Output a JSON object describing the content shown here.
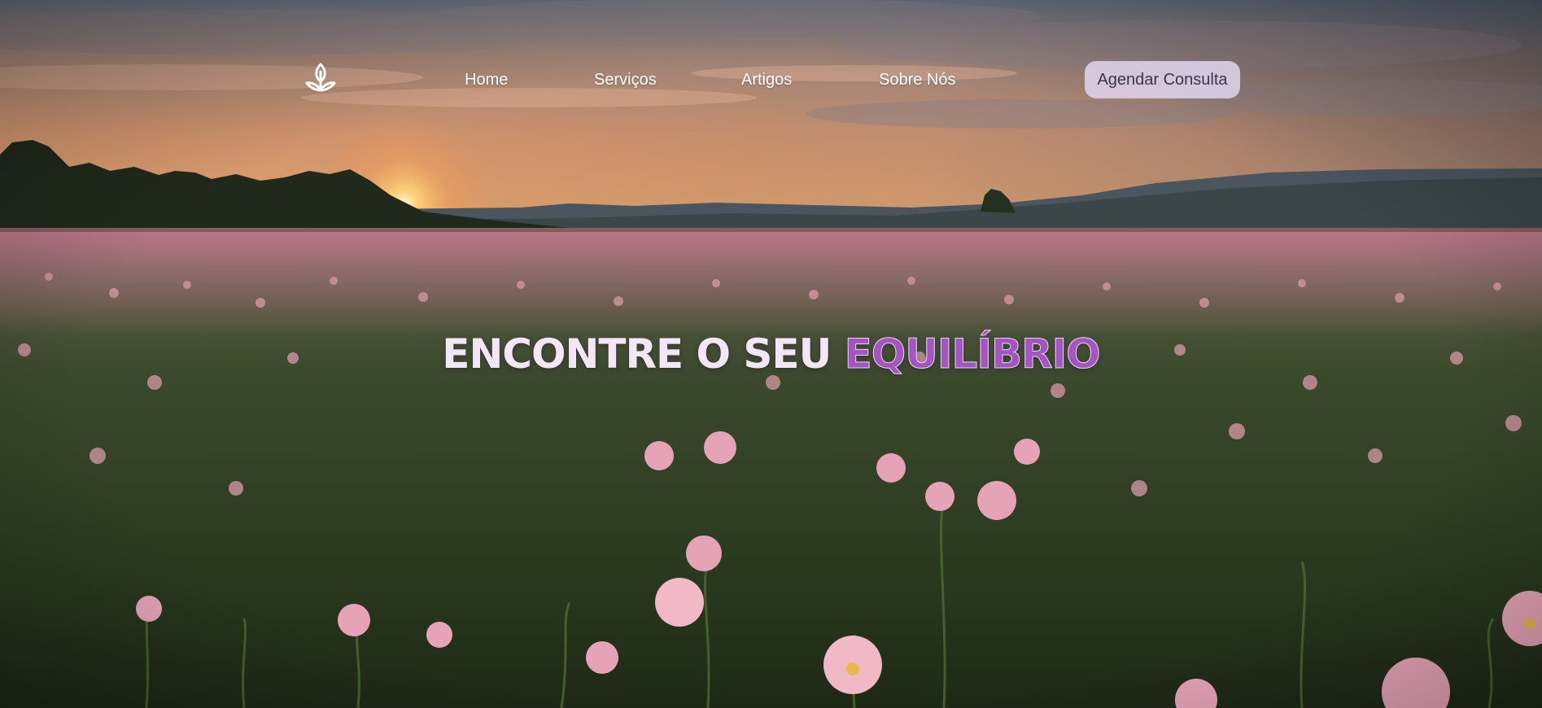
{
  "nav": {
    "logo_icon": "sprout-lotus-icon",
    "links": [
      {
        "label": "Home"
      },
      {
        "label": "Serviços"
      },
      {
        "label": "Artigos"
      },
      {
        "label": "Sobre Nós"
      }
    ],
    "cta_label": "Agendar Consulta"
  },
  "hero": {
    "headline_main": "ENCONTRE O SEU",
    "headline_accent": "EQUILÍBRIO",
    "background": "sunset-flower-field",
    "colors": {
      "accent": "#a455c4",
      "headline": "#f3e6f8",
      "cta_bg": "#ddd3ec",
      "cta_text": "#3a3550"
    }
  }
}
